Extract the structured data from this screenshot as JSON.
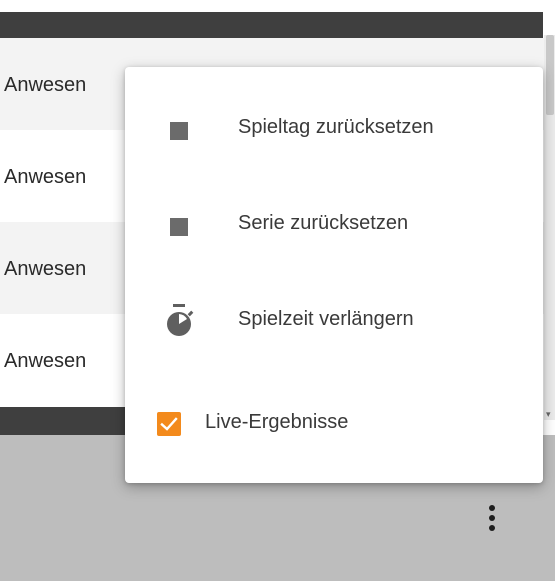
{
  "list": {
    "rows": [
      {
        "text": "Anwesen"
      },
      {
        "text": "Anwesen"
      },
      {
        "text": "Anwesen"
      },
      {
        "text": "Anwesen"
      }
    ]
  },
  "menu": {
    "items": [
      {
        "label": "Spieltag zurücksetzen",
        "icon": "square-icon"
      },
      {
        "label": "Serie zurücksetzen",
        "icon": "square-icon"
      },
      {
        "label": "Spielzeit verlängern",
        "icon": "stopwatch-icon"
      }
    ],
    "live": {
      "label": "Live-Ergebnisse",
      "checked": true
    }
  },
  "footer": {
    "icon": "more-vertical-icon"
  },
  "colors": {
    "accent": "#f38a1c",
    "dark_bar": "#3f3f3f",
    "footer": "#bdbdbd"
  }
}
